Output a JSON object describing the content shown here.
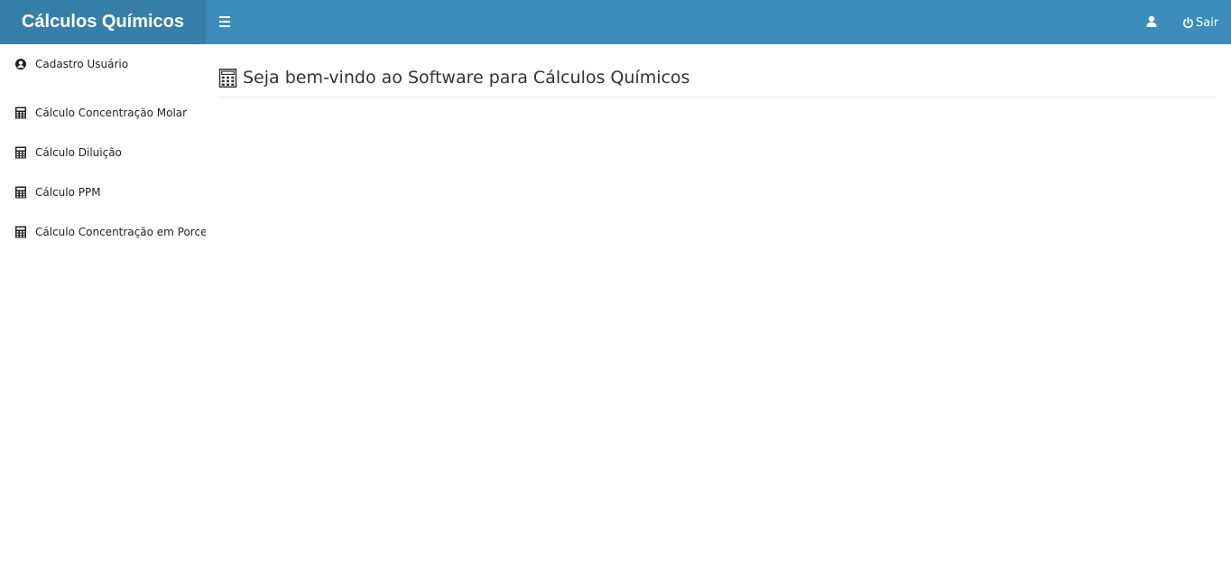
{
  "app": {
    "brand": "Cálculos Químicos"
  },
  "header": {
    "menu_icon": "bars-icon",
    "user_icon": "user-icon",
    "logout": {
      "icon": "power-icon",
      "label": "Sair"
    }
  },
  "sidebar": {
    "items": [
      {
        "icon": "user-circle-icon",
        "label": "Cadastro Usuário"
      },
      {
        "icon": "calculator-icon",
        "label": "Cálculo Concentração Molar"
      },
      {
        "icon": "calculator-icon",
        "label": "Cálculo Diluição"
      },
      {
        "icon": "calculator-icon",
        "label": "Cálculo PPM"
      },
      {
        "icon": "calculator-icon",
        "label": "Cálculo Concentração em Porcentagem"
      }
    ]
  },
  "main": {
    "title_icon": "calculator-icon",
    "title": "Seja bem-vindo ao Software para Cálculos Químicos"
  },
  "colors": {
    "header": "#3c8dbc",
    "brand_bg": "#367fa9",
    "text": "#333333"
  }
}
